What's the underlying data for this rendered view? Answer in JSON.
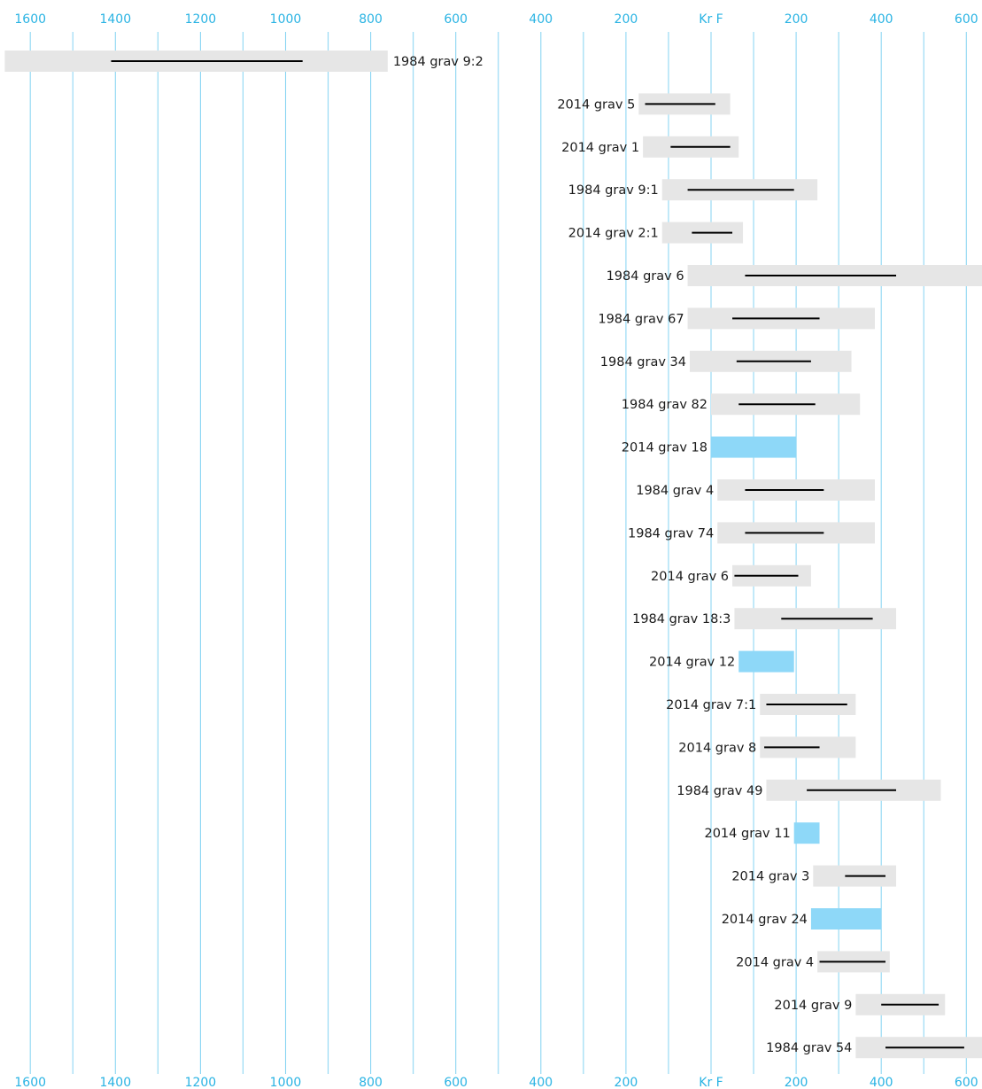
{
  "chart_data": {
    "type": "range",
    "title": "",
    "xlabel": "",
    "ylabel": "",
    "xlim": [
      -1660,
      644
    ],
    "axis": {
      "grid": true,
      "grid_step": 100,
      "tick_values": [
        -1600,
        -1400,
        -1200,
        -1000,
        -800,
        -600,
        -400,
        -200,
        0,
        200,
        400,
        600
      ],
      "tick_labels": [
        "1600",
        "1400",
        "1200",
        "1000",
        "800",
        "600",
        "400",
        "200",
        "Kr F",
        "200",
        "400",
        "600"
      ],
      "positions": [
        "top",
        "bottom"
      ]
    },
    "colors": {
      "axis": "#29b3e3",
      "grid": "#8fd7f3",
      "range_bar": "#e6e6e6",
      "highlight_bar": "#8ed8f8",
      "line": "#000000",
      "label": "#1a1a1a"
    },
    "series": [
      {
        "name": "1984 grav 9:2",
        "bar": [
          -1660,
          -760
        ],
        "line": [
          -1410,
          -960
        ],
        "highlight": false
      },
      {
        "name": "2014 grav 5",
        "bar": [
          -170,
          45
        ],
        "line": [
          -155,
          10
        ],
        "highlight": false
      },
      {
        "name": "2014 grav 1",
        "bar": [
          -160,
          65
        ],
        "line": [
          -95,
          45
        ],
        "highlight": false
      },
      {
        "name": "1984 grav 9:1",
        "bar": [
          -115,
          250
        ],
        "line": [
          -55,
          195
        ],
        "highlight": false
      },
      {
        "name": "2014 grav 2:1",
        "bar": [
          -115,
          75
        ],
        "line": [
          -45,
          50
        ],
        "highlight": false
      },
      {
        "name": "1984 grav 6",
        "bar": [
          -55,
          644
        ],
        "line": [
          80,
          435
        ],
        "highlight": false
      },
      {
        "name": "1984 grav 67",
        "bar": [
          -55,
          385
        ],
        "line": [
          50,
          255
        ],
        "highlight": false
      },
      {
        "name": "1984 grav 34",
        "bar": [
          -50,
          330
        ],
        "line": [
          60,
          235
        ],
        "highlight": false
      },
      {
        "name": "1984 grav 82",
        "bar": [
          0,
          350
        ],
        "line": [
          65,
          245
        ],
        "highlight": false
      },
      {
        "name": "2014 grav 18",
        "bar": [
          0,
          200
        ],
        "highlight": true
      },
      {
        "name": "1984 grav 4",
        "bar": [
          15,
          385
        ],
        "line": [
          80,
          265
        ],
        "highlight": false
      },
      {
        "name": "1984 grav 74",
        "bar": [
          15,
          385
        ],
        "line": [
          80,
          265
        ],
        "highlight": false
      },
      {
        "name": "2014 grav 6",
        "bar": [
          50,
          235
        ],
        "line": [
          55,
          205
        ],
        "highlight": false
      },
      {
        "name": "1984 grav 18:3",
        "bar": [
          55,
          435
        ],
        "line": [
          165,
          380
        ],
        "highlight": false
      },
      {
        "name": "2014 grav 12",
        "bar": [
          65,
          195
        ],
        "highlight": true
      },
      {
        "name": "2014 grav 7:1",
        "bar": [
          115,
          340
        ],
        "line": [
          130,
          320
        ],
        "highlight": false
      },
      {
        "name": "2014 grav 8",
        "bar": [
          115,
          340
        ],
        "line": [
          125,
          255
        ],
        "highlight": false
      },
      {
        "name": "1984 grav 49",
        "bar": [
          130,
          540
        ],
        "line": [
          225,
          435
        ],
        "highlight": false
      },
      {
        "name": "2014 grav 11",
        "bar": [
          195,
          255
        ],
        "highlight": true
      },
      {
        "name": "2014 grav 3",
        "bar": [
          240,
          435
        ],
        "line": [
          315,
          410
        ],
        "highlight": false
      },
      {
        "name": "2014 grav 24",
        "bar": [
          235,
          400
        ],
        "highlight": true
      },
      {
        "name": "2014 grav 4",
        "bar": [
          250,
          420
        ],
        "line": [
          255,
          410
        ],
        "highlight": false
      },
      {
        "name": "2014 grav 9",
        "bar": [
          340,
          550
        ],
        "line": [
          400,
          535
        ],
        "highlight": false
      },
      {
        "name": "1984 grav 54",
        "bar": [
          340,
          644
        ],
        "line": [
          410,
          595
        ],
        "highlight": false
      }
    ]
  }
}
